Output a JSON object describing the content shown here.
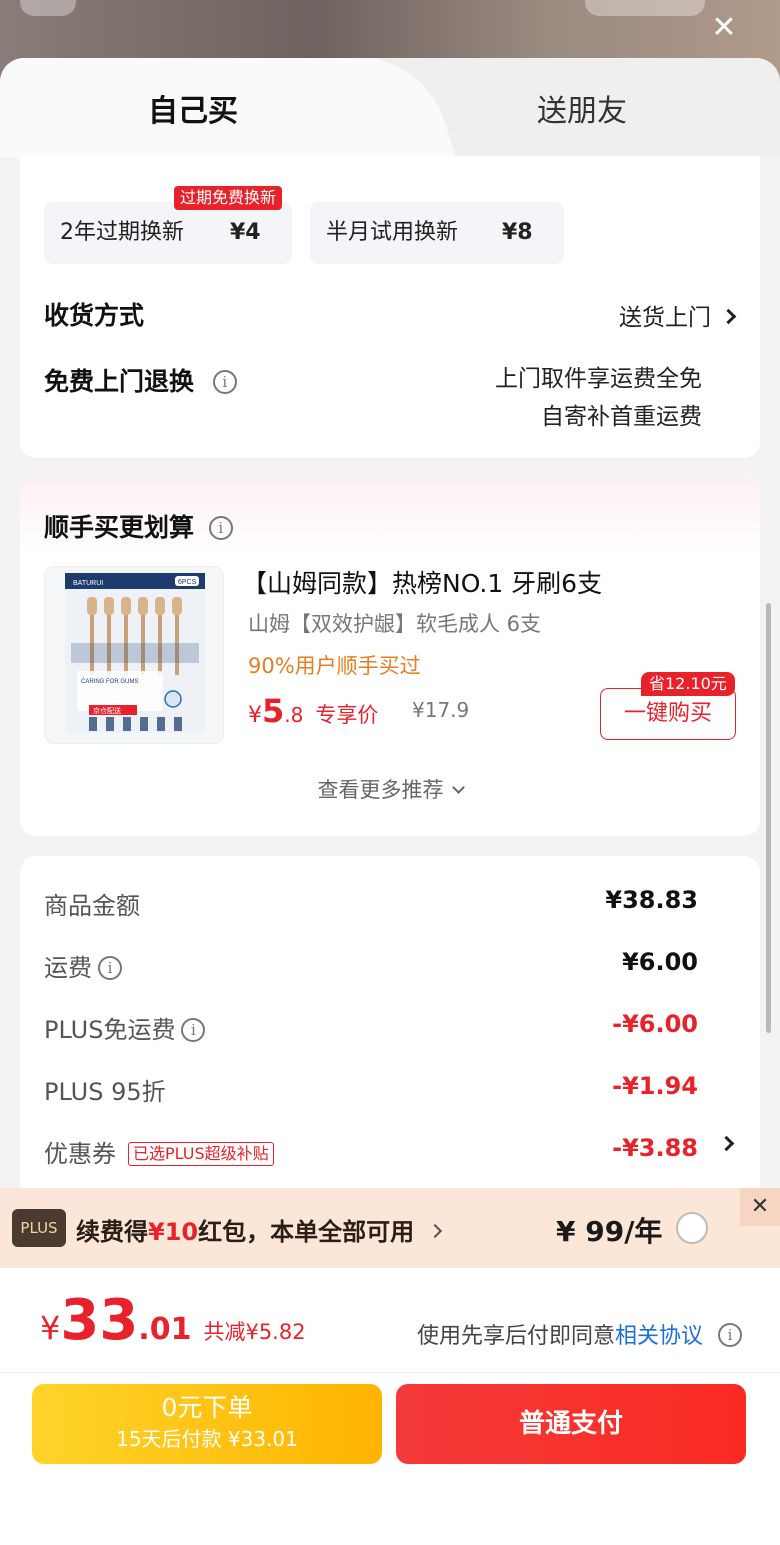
{
  "tabs": {
    "buy_self": "自己买",
    "send_friend": "送朋友"
  },
  "service_options": {
    "badge": "过期免费换新",
    "items": [
      {
        "name": "2年过期换新",
        "price": "¥4"
      },
      {
        "name": "半月试用换新",
        "price": "¥8"
      }
    ]
  },
  "delivery": {
    "label": "收货方式",
    "value": "送货上门"
  },
  "free_return": {
    "label": "免费上门退换",
    "lines": [
      "上门取件享运费全免",
      "自寄补首重运费"
    ]
  },
  "recommend": {
    "title": "顺手买更划算",
    "product": {
      "title": "【山姆同款】热榜NO.1 牙刷6支",
      "subtitle": "山姆【双效护龈】软毛成人 6支",
      "popularity": "90%用户顺手买过",
      "price_currency": "¥",
      "price_int": "5",
      "price_dec": ".8",
      "price_tag": "专享价",
      "original_price": "¥17.9",
      "save_badge": "省12.10元",
      "buy_button": "一键购买",
      "image_brand": "BATURUI",
      "image_count": "6PCS",
      "image_text": "CARING FOR GUMS",
      "image_jd": "京仓配送"
    },
    "more": "查看更多推荐"
  },
  "summary": [
    {
      "label": "商品金额",
      "value": "¥38.83",
      "info": false
    },
    {
      "label": "运费",
      "value": "¥6.00",
      "info": true
    },
    {
      "label": "PLUS免运费",
      "value": "-¥6.00",
      "info": true
    },
    {
      "label": "PLUS 95折",
      "value": "-¥1.94",
      "info": false
    },
    {
      "label": "优惠券",
      "value": "-¥3.88",
      "tag": "已选PLUS超级补贴"
    }
  ],
  "plus_bar": {
    "logo": "PLUS",
    "text_pre": "续费得",
    "text_highlight": "¥10",
    "text_post": "红包，本单全部可用",
    "price": "¥ 99/年"
  },
  "total": {
    "currency": "¥",
    "int": "33",
    "dec": ".01",
    "reduction": "共减¥5.82"
  },
  "agreement": {
    "text": "使用先享后付即同意",
    "link": "相关协议"
  },
  "buttons": {
    "pay_later_line1": "0元下单",
    "pay_later_line2": "15天后付款 ¥33.01",
    "pay": "普通支付"
  },
  "colors": {
    "accent": "#e8222a",
    "pay_later": "#ffc21a",
    "link": "#1e6fd9"
  }
}
